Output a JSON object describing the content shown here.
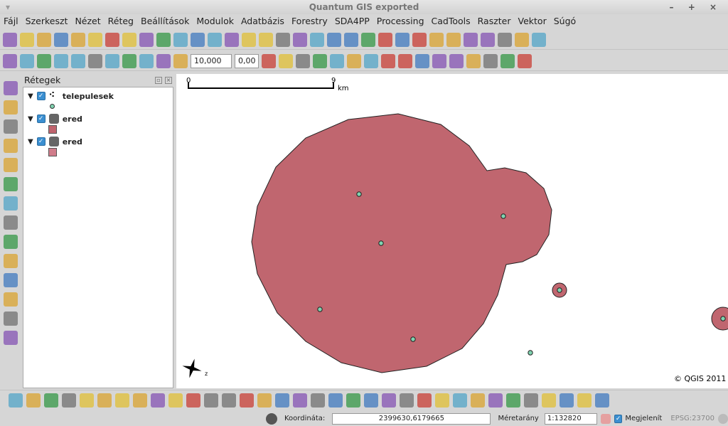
{
  "window": {
    "title": "Quantum GIS exported",
    "controls": "– + ×"
  },
  "menu": [
    "Fájl",
    "Szerkeszt",
    "Nézet",
    "Réteg",
    "Beállítások",
    "Modulok",
    "Adatbázis",
    "Forestry",
    "SDA4PP",
    "Processing",
    "CadTools",
    "Raszter",
    "Vektor",
    "Súgó"
  ],
  "toolbar1": {
    "icons": [
      "new-project",
      "open-project",
      "save",
      "save-as",
      "print-composer",
      "composer-manager",
      "add-vector",
      "add-raster",
      "add-postgis",
      "add-spatialite",
      "add-wms",
      "add-wfs",
      "new-layer",
      "remove-layer",
      "add-delimited",
      "add-oracle",
      "select-feature",
      "identify",
      "measure",
      "attribute-table",
      "measure-line",
      "annotation",
      "openlayers",
      "hide-plugin",
      "home",
      "text-annotation",
      "help",
      "whats-this",
      "grass-1",
      "grass-2",
      "plugin-a",
      "plugin-b"
    ]
  },
  "toolbar2": {
    "icons": [
      "toggle-edit",
      "save-edits",
      "add-feature",
      "move-feature",
      "node-tool",
      "delete-selected",
      "cut",
      "copy",
      "paste",
      "simplify",
      "rotate-point"
    ],
    "scale_value": "10,000",
    "tolerance_value": "0,00",
    "icons2": [
      "undo",
      "redo",
      "add-ring",
      "add-part",
      "fill-ring",
      "delete-ring",
      "delete-part",
      "reshape",
      "offset-curve",
      "split",
      "merge",
      "merge-attr",
      "rotate",
      "label-a",
      "label-b",
      "label-c"
    ]
  },
  "left_toolbar": [
    "pan",
    "zoom-in",
    "zoom-out",
    "zoom-full",
    "zoom-selection",
    "zoom-layer",
    "zoom-native",
    "zoom-last",
    "zoom-next",
    "refresh",
    "label-tool",
    "pin-label",
    "move-label",
    "rotate-label"
  ],
  "layers_panel": {
    "title": "Rétegek",
    "layers": [
      {
        "name": "telepulesek",
        "symbol": "point",
        "color": "#7fd3b0"
      },
      {
        "name": "ered",
        "symbol": "polygon",
        "color": "#c0646e"
      },
      {
        "name": "ered",
        "symbol": "polygon",
        "color": "#d07c8a"
      }
    ]
  },
  "map": {
    "scalebar": {
      "start": "0",
      "end": "9",
      "unit": "km"
    },
    "copyright": "© QGIS 2011",
    "polygon_fill": "#c0666f",
    "point_fill": "#7fd3b0"
  },
  "bottom_toolbar": [
    "georeferencer",
    "heatmap",
    "d2s",
    "zonal",
    "osm",
    "gps",
    "globe",
    "interpolation",
    "north-arrow",
    "gdal",
    "fTools",
    "spatial-query",
    "road-graph",
    "table-manager",
    "topology",
    "bus",
    "dxf",
    "raster-calc",
    "statistics",
    "calendar",
    "time-manager",
    "edit",
    "spit",
    "connect",
    "convert",
    "p2",
    "grid",
    "binoculars",
    "photo",
    "profile",
    "chart",
    "sql",
    "dxf2shp",
    "lemon"
  ],
  "status": {
    "coord_label": "Koordináta:",
    "coord_value": "2399630,6179665",
    "scale_label": "Méretarány",
    "scale_value": "1:132820",
    "render_label": "Megjelenít",
    "crs": "EPSG:23700"
  }
}
